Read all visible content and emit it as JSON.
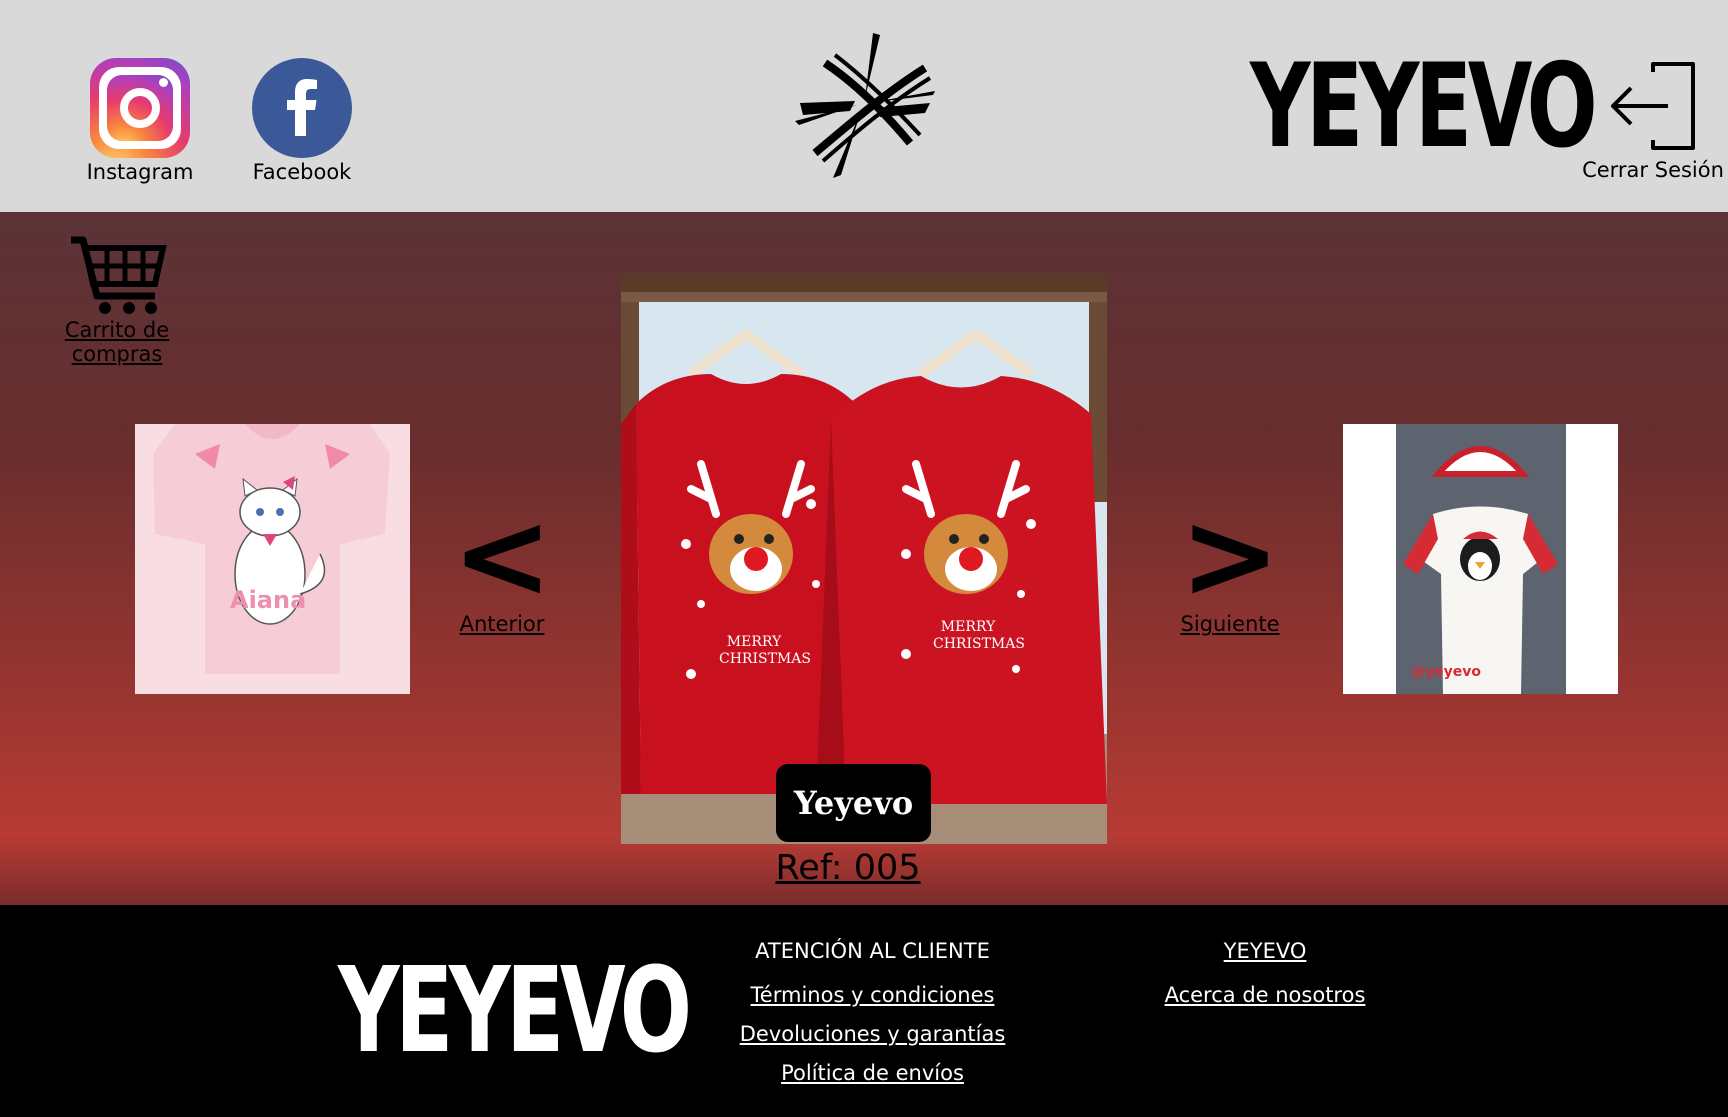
{
  "header": {
    "social": [
      {
        "label": "Instagram",
        "icon": "instagram-icon"
      },
      {
        "label": "Facebook",
        "icon": "facebook-icon"
      }
    ],
    "brand": "YEYEVO",
    "logout_label": "Cerrar Sesión"
  },
  "main": {
    "cart_label": "Carrito de compras",
    "prev_arrow": "<",
    "prev_label": "Anterior",
    "next_arrow": ">",
    "next_label": "Siguiente",
    "ref": "Ref: 005",
    "photo_badge": "Yeyevo",
    "thumb_left_caption": "Aiana",
    "thumb_right_caption": "@yeyevo",
    "photo_text": "MERRY CHRISTMAS"
  },
  "footer": {
    "brand": "YEYEVO",
    "column1": {
      "heading": "ATENCIÓN AL CLIENTE",
      "links": [
        "Términos y condiciones",
        "Devoluciones y garantías",
        "Política de envíos"
      ]
    },
    "column2": {
      "heading": "YEYEVO",
      "links": [
        "Acerca de nosotros"
      ]
    }
  },
  "colors": {
    "header_bg": "#d9d9d9",
    "footer_bg": "#000000",
    "facebook": "#3b5998",
    "sweater_red": "#c8101e"
  }
}
